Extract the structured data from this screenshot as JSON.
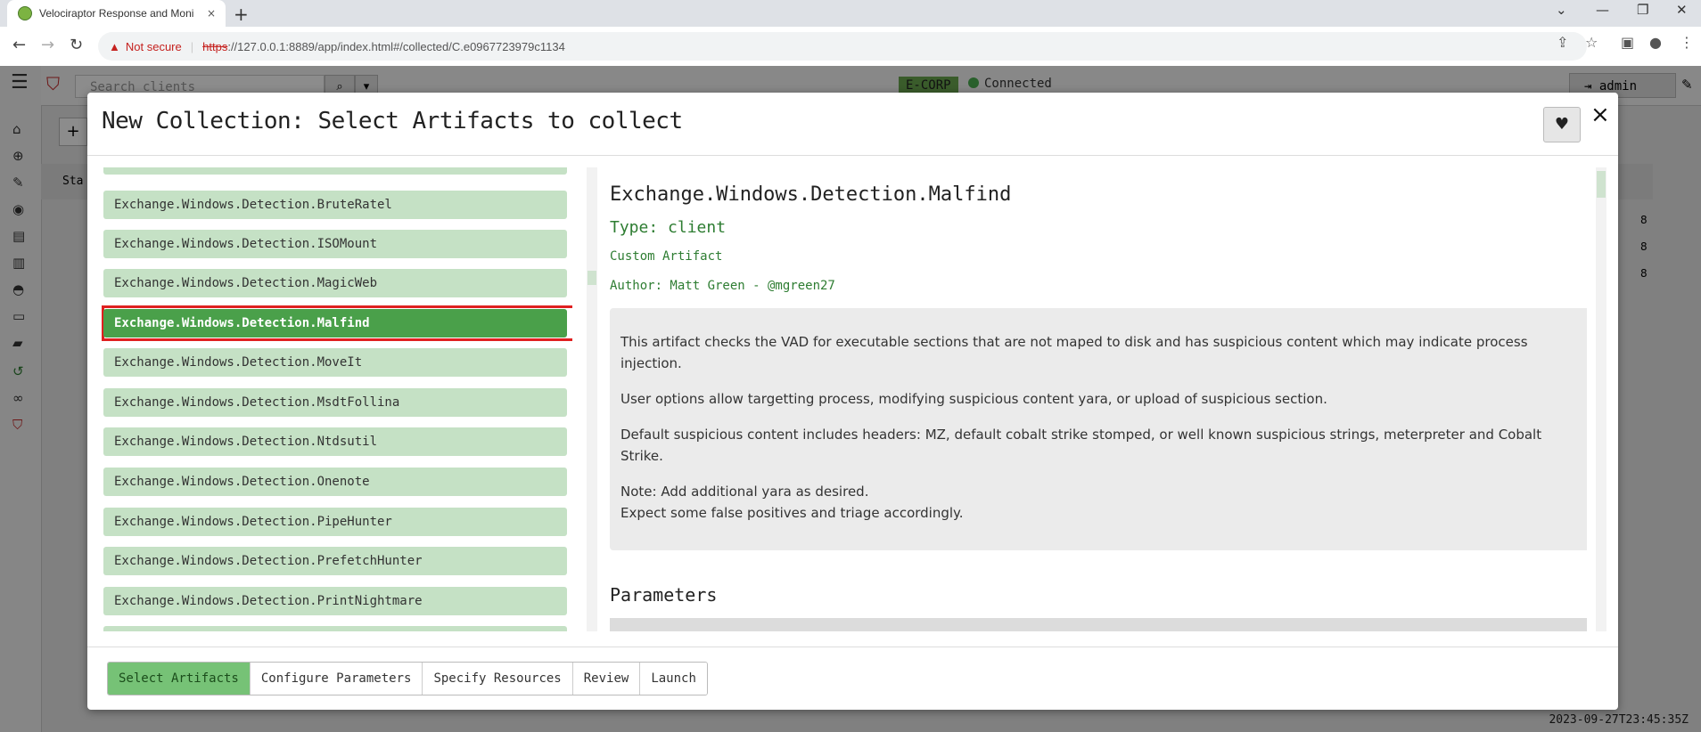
{
  "browser": {
    "tab_title": "Velociraptor Response and Moni",
    "tab_close": "×",
    "new_tab": "+",
    "not_secure": "Not secure",
    "warning": "▲",
    "scheme": "https",
    "url_rest": "://127.0.0.1:8889/app/index.html#/collected/C.e0967723979c1134",
    "controls": {
      "minimize": "⌄",
      "min": "—",
      "restore": "❐",
      "close": "✕"
    }
  },
  "app": {
    "search_placeholder": "Search clients",
    "org": "E-CORP",
    "connection": "Connected",
    "username": "admin",
    "timestamp": "2023-09-27T23:45:35Z",
    "bg_labels": {
      "st": "Sta",
      "plus": "+"
    },
    "bg_counts": [
      "8",
      "8",
      "8"
    ]
  },
  "modal": {
    "title": "New Collection: Select Artifacts to collect",
    "close": "×",
    "artifacts": [
      "",
      "Exchange.Windows.Detection.BruteRatel",
      "Exchange.Windows.Detection.ISOMount",
      "Exchange.Windows.Detection.MagicWeb",
      "Exchange.Windows.Detection.Malfind",
      "Exchange.Windows.Detection.MoveIt",
      "Exchange.Windows.Detection.MsdtFollina",
      "Exchange.Windows.Detection.Ntdsutil",
      "Exchange.Windows.Detection.Onenote",
      "Exchange.Windows.Detection.PipeHunter",
      "Exchange.Windows.Detection.PrefetchHunter",
      "Exchange.Windows.Detection.PrintNightmare",
      ""
    ],
    "selected_index": 4,
    "detail": {
      "name": "Exchange.Windows.Detection.Malfind",
      "type": "Type: client",
      "custom": "Custom Artifact",
      "author": "Author: Matt Green - @mgreen27",
      "desc1": "This artifact checks the VAD for executable sections that are not maped to disk and has suspicious content which may indicate process injection.",
      "desc2": "User options allow targetting process, modifying suspicious content yara, or upload of suspicious section.",
      "desc3": "Default suspicious content includes headers: MZ, default cobalt strike stomped, or well known suspicious strings, meterpreter and Cobalt Strike.",
      "note1": "Note: Add additional yara as desired.",
      "note2": "Expect some false positives and triage accordingly.",
      "parameters_heading": "Parameters"
    },
    "wizard": [
      "Select Artifacts",
      "Configure Parameters",
      "Specify Resources",
      "Review",
      "Launch"
    ],
    "wizard_active": 0
  },
  "colors": {
    "accent_green": "#4aa04a",
    "item_green": "#c5e1c5",
    "highlight_red": "#e02020"
  }
}
